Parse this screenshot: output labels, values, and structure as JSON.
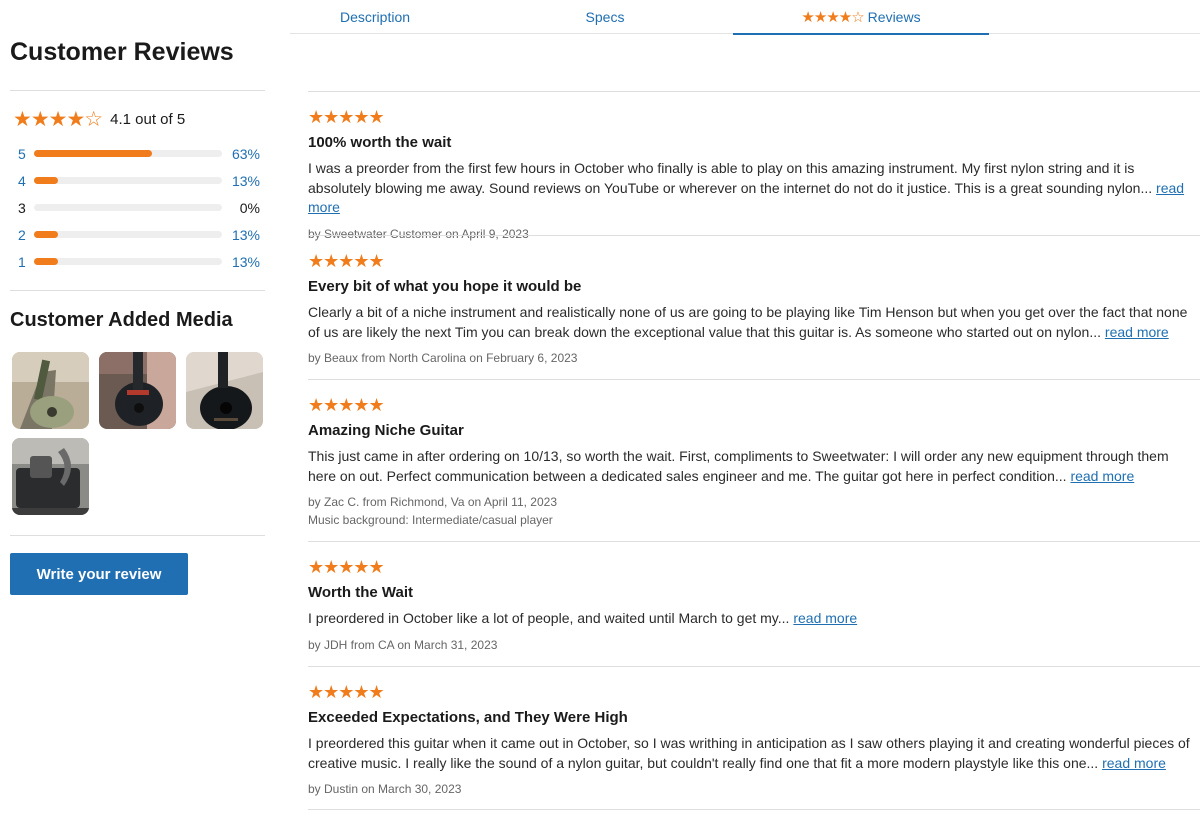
{
  "tabs": [
    {
      "label": "Description"
    },
    {
      "label": "Specs"
    },
    {
      "stars": "★★★★☆",
      "label": "Reviews"
    }
  ],
  "page_title": "Customer Reviews",
  "summary": {
    "stars": "★★★★☆",
    "score_text": "4.1 out of 5",
    "rating": 4.1
  },
  "distribution": [
    {
      "label": "5",
      "percent": 63,
      "percent_text": "63%"
    },
    {
      "label": "4",
      "percent": 13,
      "percent_text": "13%"
    },
    {
      "label": "3",
      "percent": 0,
      "percent_text": "0%"
    },
    {
      "label": "2",
      "percent": 13,
      "percent_text": "13%"
    },
    {
      "label": "1",
      "percent": 13,
      "percent_text": "13%"
    }
  ],
  "media": {
    "title": "Customer Added Media"
  },
  "write_review_label": "Write your review",
  "colors": {
    "accent": "#f07c1b",
    "link": "#1f6fb2"
  },
  "reviews": [
    {
      "stars": "★★★★★",
      "title": "100% worth the wait",
      "body": "I was a preorder from the first few hours in October who finally is able to play on this amazing instrument. My first nylon string and it is absolutely blowing me away. Sound reviews on YouTube or wherever on the internet do not do it justice. This is a great sounding nylon...",
      "more": "read more",
      "meta": "by Sweetwater Customer on April 9, 2023",
      "extra": ""
    },
    {
      "stars": "★★★★★",
      "title": "Every bit of what you hope it would be",
      "body": "Clearly a bit of a niche instrument and realistically none of us are going to be playing like Tim Henson but when you get over the fact that none of us are likely the next Tim you can break down the exceptional value that this guitar is. As someone who started out on nylon...",
      "more": "read more",
      "meta": "by Beaux from North Carolina on February 6, 2023",
      "extra": ""
    },
    {
      "stars": "★★★★★",
      "title": "Amazing Niche Guitar",
      "body": "This just came in after ordering on 10/13, so worth the wait. First, compliments to Sweetwater: I will order any new equipment through them here on out. Perfect communication between a dedicated sales engineer and me. The guitar got here in perfect condition...",
      "more": "read more",
      "meta": "by Zac C. from Richmond, Va on April 11, 2023",
      "extra": "Music background: Intermediate/casual player"
    },
    {
      "stars": "★★★★★",
      "title": "Worth the Wait",
      "body": "I preordered in October like a lot of people, and waited until March to get my...",
      "more": "read more",
      "meta": "by JDH from CA on March 31, 2023",
      "extra": ""
    },
    {
      "stars": "★★★★★",
      "title": "Exceeded Expectations, and They Were High",
      "body": "I preordered this guitar when it came out in October, so I was writhing in anticipation as I saw others playing it and creating wonderful pieces of creative music. I really like the sound of a nylon guitar, but couldn't really find one that fit a more modern playstyle like this one...",
      "more": "read more",
      "meta": "by Dustin on March 30, 2023",
      "extra": ""
    }
  ]
}
